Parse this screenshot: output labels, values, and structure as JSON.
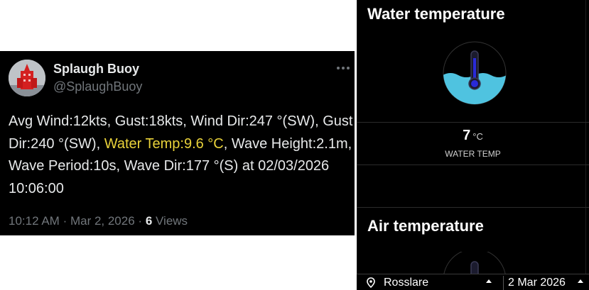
{
  "tweet": {
    "display_name": "Splaugh Buoy",
    "handle": "@SplaughBuoy",
    "body_pre": "Avg Wind:12kts, Gust:18kts, Wind Dir:247 °(SW), Gust Dir:240 °(SW), ",
    "body_highlight": "Water Temp:9.6 °C",
    "body_post": ", Wave Height:2.1m, Wave Period:10s, Wave Dir:177 °(S) at 02/03/2026 10:06:00",
    "time": "10:12 AM",
    "date": "Mar 2, 2026",
    "views_count": "6",
    "views_label": "Views",
    "highlight_color": "#e9d23a",
    "more_icon": "more-horizontal-icon"
  },
  "phone": {
    "water_section_title": "Water temperature",
    "water_value": "7",
    "water_unit": "°C",
    "water_label": "WATER TEMP",
    "air_section_title": "Air temperature",
    "location": "Rosslare",
    "date": "2 Mar 2026",
    "gauge_fill_color": "#4fc3e0",
    "location_icon": "location-pin-icon"
  }
}
